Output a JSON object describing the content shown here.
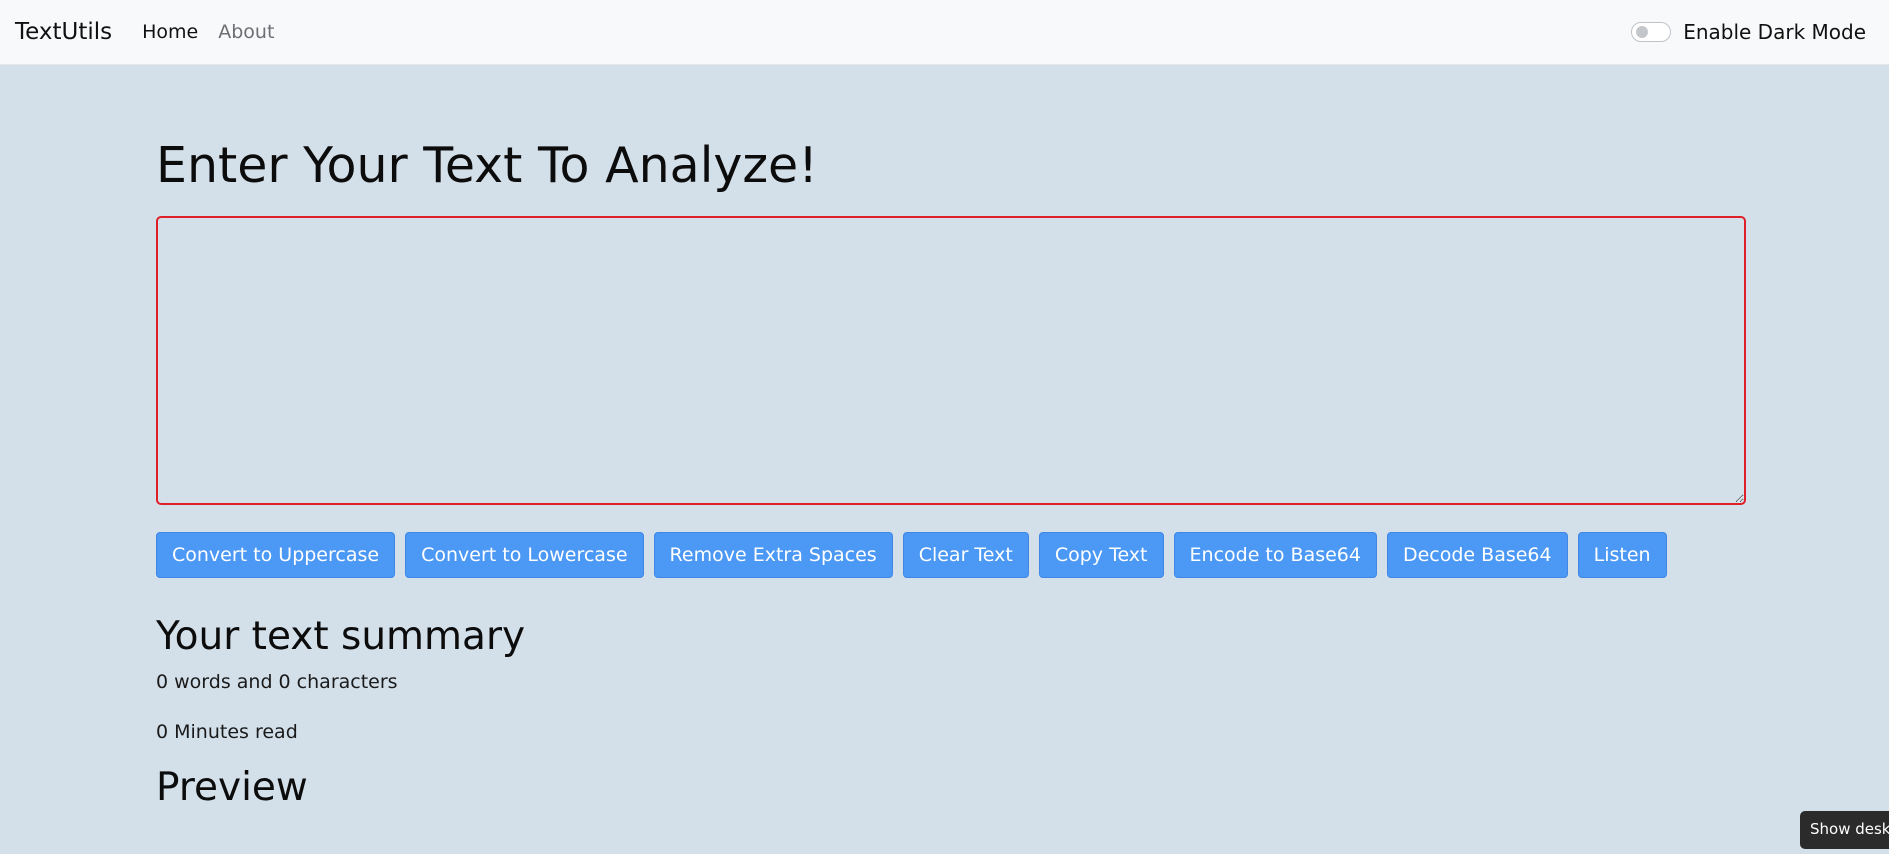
{
  "navbar": {
    "brand": "TextUtils",
    "links": [
      "Home",
      "About"
    ],
    "dark_mode_label": "Enable Dark Mode"
  },
  "main": {
    "title": "Enter Your Text To Analyze!",
    "textarea_value": "",
    "buttons": [
      "Convert to Uppercase",
      "Convert to Lowercase",
      "Remove Extra Spaces",
      "Clear Text",
      "Copy Text",
      "Encode to Base64",
      "Decode Base64",
      "Listen"
    ],
    "summary_title": "Your text summary",
    "word_char_count": "0 words and 0 characters",
    "minutes_read": "0 Minutes read",
    "preview_title": "Preview"
  },
  "tooltip": {
    "text": "Show desktop"
  },
  "colors": {
    "background": "#d3e0ea",
    "navbar": "#f8f9fa",
    "button": "#4b98f5",
    "textarea_border": "#e02028"
  }
}
